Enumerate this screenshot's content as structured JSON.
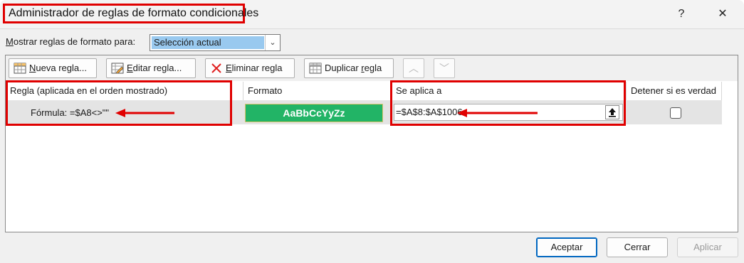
{
  "window": {
    "title": "Administrador de reglas de formato condicionales",
    "help": "?",
    "close": "✕"
  },
  "show_rules": {
    "label_prefix": "M",
    "label_rest": "ostrar reglas de formato para:",
    "selected": "Selección actual"
  },
  "toolbar": {
    "new_rule_prefix": "N",
    "new_rule_rest": "ueva regla...",
    "edit_rule_prefix": "E",
    "edit_rule_rest": "ditar regla...",
    "delete_rule_prefix": "E",
    "delete_rule_rest": "liminar regla",
    "duplicate_rule_prefix": "Duplicar ",
    "duplicate_rule_u": "r",
    "duplicate_rule_rest": "egla",
    "move_up": "︿",
    "move_down": "﹀"
  },
  "table": {
    "headers": [
      "Regla (aplicada en el orden mostrado)",
      "Formato",
      "Se aplica a",
      "Detener si es verdad"
    ],
    "rows": [
      {
        "rule": "Fórmula: =$A8<>\"\"",
        "format_preview": "AaBbCcYyZz",
        "applies_to": "=$A$8:$A$1006",
        "stop_if_true": false
      }
    ]
  },
  "buttons": {
    "ok": "Aceptar",
    "close": "Cerrar",
    "apply": "Aplicar"
  },
  "colors": {
    "annotation": "#e00000",
    "format_fill": "#22b466",
    "selection": "#99c9ef"
  }
}
